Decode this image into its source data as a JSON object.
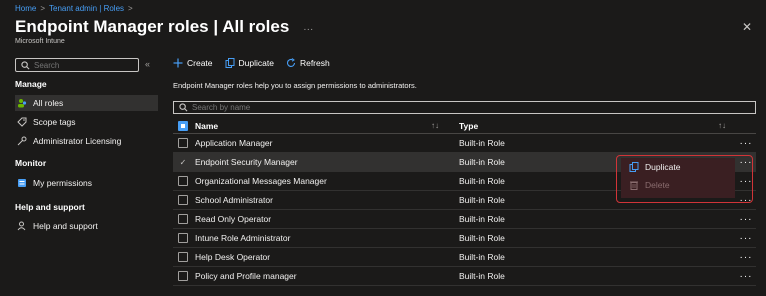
{
  "breadcrumb": [
    "Home",
    "Tenant admin | Roles"
  ],
  "header": {
    "title": "Endpoint Manager roles | All roles",
    "more": "···",
    "subtitle": "Microsoft Intune",
    "close": "✕"
  },
  "sidebar": {
    "search_placeholder": "Search",
    "collapse": "«",
    "sections": [
      {
        "label": "Manage",
        "items": [
          {
            "label": "All roles",
            "icon": "user-roles-icon",
            "active": true
          },
          {
            "label": "Scope tags",
            "icon": "tag-icon",
            "active": false
          },
          {
            "label": "Administrator Licensing",
            "icon": "key-icon",
            "active": false
          }
        ]
      },
      {
        "label": "Monitor",
        "items": [
          {
            "label": "My permissions",
            "icon": "permissions-icon",
            "active": false
          }
        ]
      },
      {
        "label": "Help and support",
        "items": [
          {
            "label": "Help and support",
            "icon": "help-person-icon",
            "active": false
          }
        ]
      }
    ]
  },
  "toolbar": {
    "create": "Create",
    "duplicate": "Duplicate",
    "refresh": "Refresh"
  },
  "description": "Endpoint Manager roles help you to assign permissions to administrators.",
  "filter_placeholder": "Search by name",
  "table": {
    "columns": [
      "Name",
      "Type"
    ],
    "rows": [
      {
        "name": "Application Manager",
        "type": "Built-in Role",
        "selected": false
      },
      {
        "name": "Endpoint Security Manager",
        "type": "Built-in Role",
        "selected": true
      },
      {
        "name": "Organizational Messages Manager",
        "type": "Built-in Role",
        "selected": false
      },
      {
        "name": "School Administrator",
        "type": "Built-in Role",
        "selected": false
      },
      {
        "name": "Read Only Operator",
        "type": "Built-in Role",
        "selected": false
      },
      {
        "name": "Intune Role Administrator",
        "type": "Built-in Role",
        "selected": false
      },
      {
        "name": "Help Desk Operator",
        "type": "Built-in Role",
        "selected": false
      },
      {
        "name": "Policy and Profile manager",
        "type": "Built-in Role",
        "selected": false
      }
    ]
  },
  "context_menu": {
    "items": [
      {
        "label": "Duplicate",
        "icon": "duplicate-icon",
        "disabled": false
      },
      {
        "label": "Delete",
        "icon": "trash-icon",
        "disabled": true
      }
    ]
  },
  "colors": {
    "accent": "#479ef5",
    "highlight_border": "#d13438",
    "background": "#1b1a19"
  }
}
